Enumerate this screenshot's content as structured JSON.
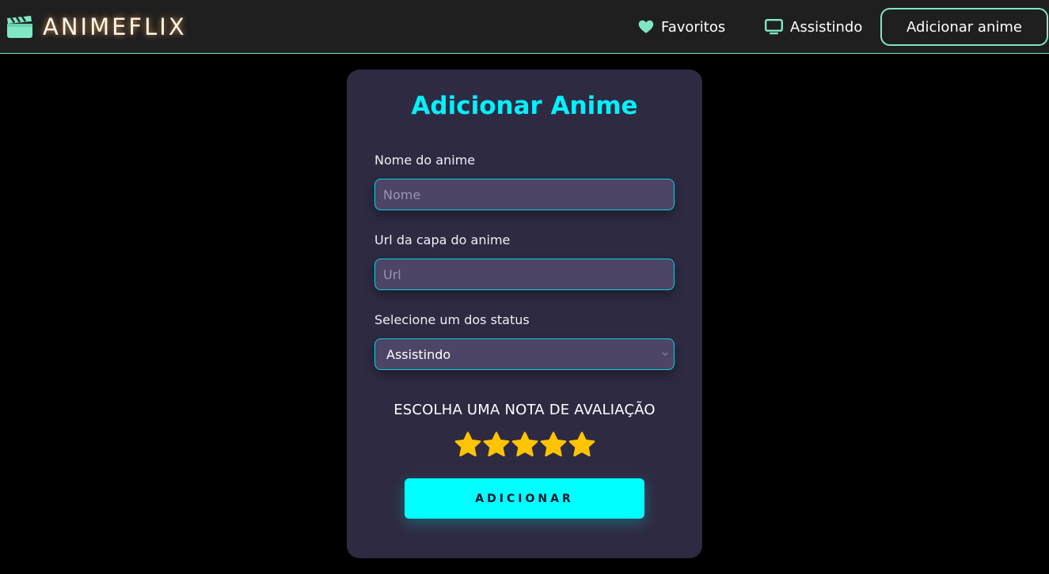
{
  "navbar": {
    "brand_icon": "clapperboard-icon",
    "brand_text": "ANIMEFLIX",
    "links": [
      {
        "icon": "heart-icon",
        "label": "Favoritos"
      },
      {
        "icon": "tv-icon",
        "label": "Assistindo"
      }
    ],
    "add_button_label": "Adicionar anime"
  },
  "form": {
    "title": "Adicionar Anime",
    "name_field": {
      "label": "Nome do anime",
      "placeholder": "Nome",
      "value": ""
    },
    "url_field": {
      "label": "Url da capa do anime",
      "placeholder": "Url",
      "value": ""
    },
    "status_field": {
      "label": "Selecione um dos status",
      "selected": "Assistindo"
    },
    "rating": {
      "label": "ESCOLHA UMA NOTA DE AVALIAÇÃO",
      "value": 5,
      "max": 5
    },
    "submit_label": "ADICIONAR"
  },
  "colors": {
    "accent_mint": "#7fe7c4",
    "accent_cyan": "#00ffff",
    "title_cyan": "#00f2ff",
    "star_gold": "#ffc400",
    "card_bg": "#2e2a42",
    "field_bg": "#4e4466"
  }
}
